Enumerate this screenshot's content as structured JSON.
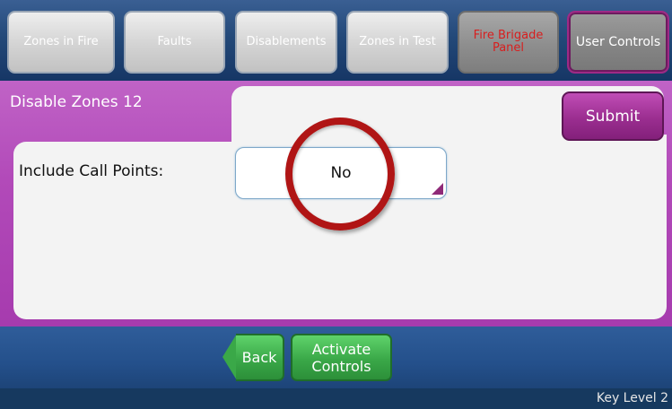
{
  "tabs": [
    {
      "label": "Zones in Fire"
    },
    {
      "label": "Faults"
    },
    {
      "label": "Disablements"
    },
    {
      "label": "Zones in Test"
    },
    {
      "label": "Fire Brigade Panel"
    },
    {
      "label": "User Controls"
    }
  ],
  "page": {
    "title": "Disable Zones 12",
    "submit_label": "Submit",
    "field_label": "Include Call Points:",
    "field_value": "No"
  },
  "bottom": {
    "back_label": "Back",
    "activate_label": "Activate Controls"
  },
  "status": {
    "key_level": "Key Level 2"
  },
  "colors": {
    "accent_purple": "#b24ab9",
    "nav_blue": "#234979",
    "alert_red": "#d81e1e",
    "button_green": "#3aa848",
    "highlight_circle": "#b01515"
  },
  "icons": {
    "dropdown_indicator": "dropdown-corner-icon",
    "highlight": "highlight-circle",
    "back_arrow": "back-arrow-icon"
  }
}
